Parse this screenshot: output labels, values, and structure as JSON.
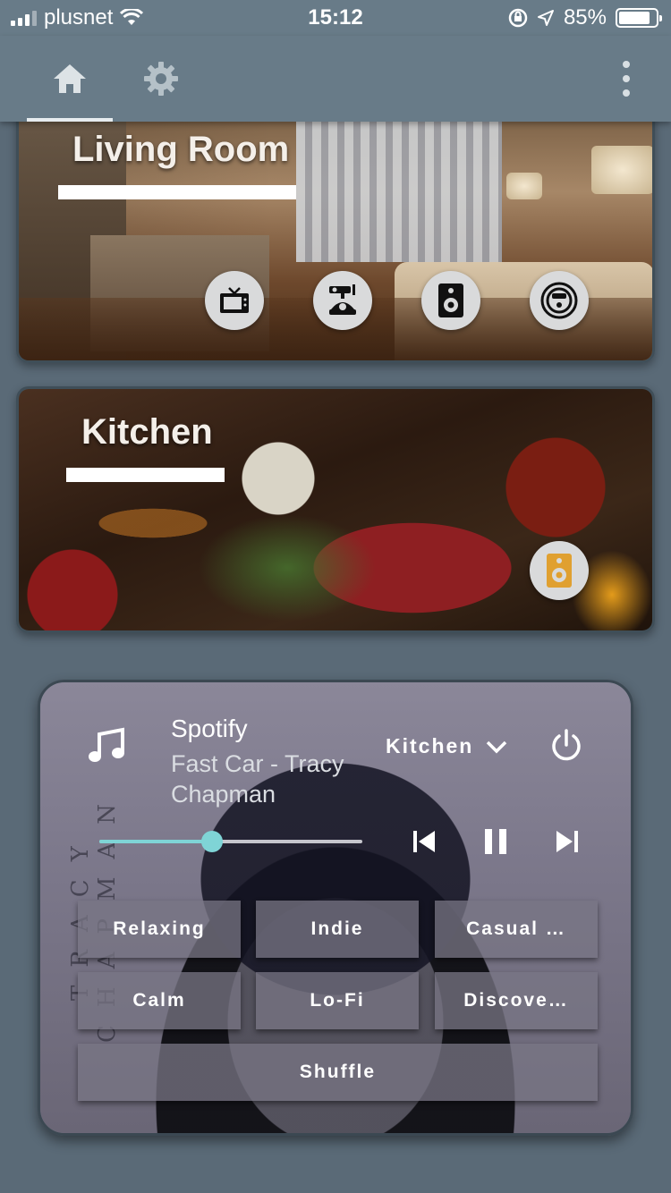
{
  "status_bar": {
    "carrier": "plusnet",
    "time": "15:12",
    "battery": "85%"
  },
  "app_bar": {
    "tabs": [
      {
        "icon": "home-icon",
        "selected": true
      },
      {
        "icon": "gear-icon",
        "selected": false
      }
    ],
    "menu_icon": "more-vert-icon"
  },
  "rooms": [
    {
      "name": "Living Room",
      "devices": [
        "tv-icon",
        "projector-icon",
        "speaker-icon",
        "robot-vacuum-icon"
      ]
    },
    {
      "name": "Kitchen",
      "devices": [
        "speaker-icon"
      ],
      "device_accent": "#e0a030"
    }
  ],
  "player": {
    "source": "Spotify",
    "track": "Fast Car - Tracy Chapman",
    "zone": "Kitchen",
    "album_art_text": "TRACY CHAPMAN",
    "volume": 0.43,
    "accent": "#7fd4d6",
    "playlists": [
      "Relaxing",
      "Indie",
      "Casual …",
      "Calm",
      "Lo-Fi",
      "Discove…"
    ],
    "shuffle_label": "Shuffle"
  },
  "colors": {
    "app_bar": "#687b88",
    "background": "#5a6a77"
  }
}
